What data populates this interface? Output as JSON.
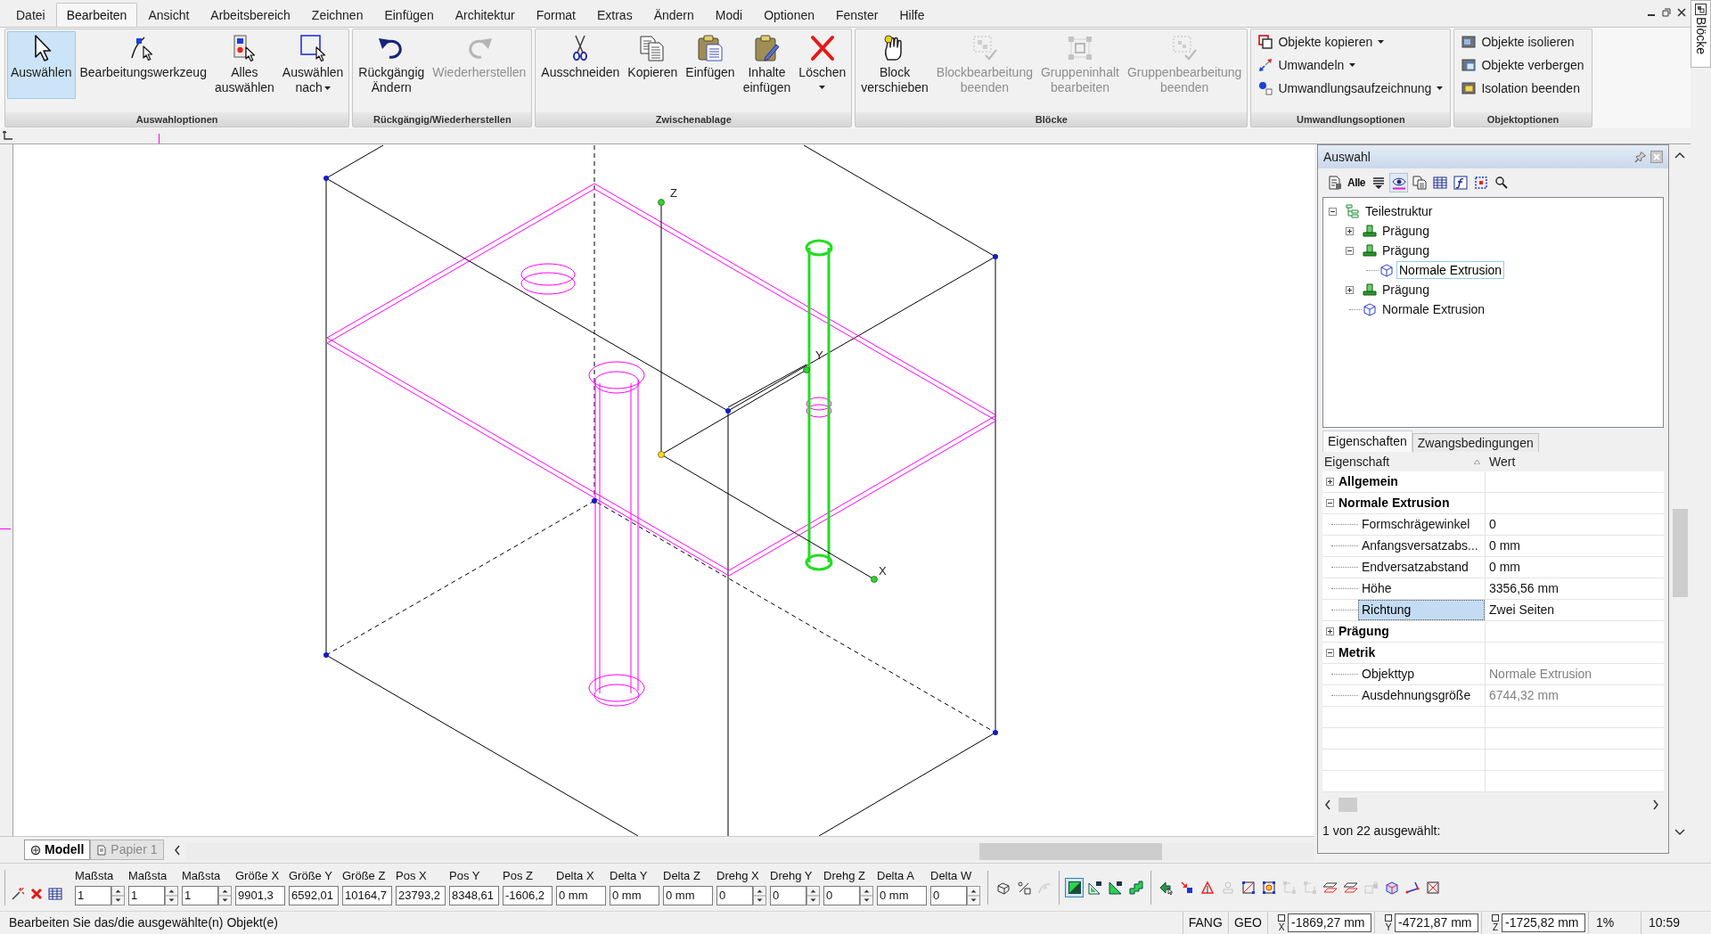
{
  "menu_bar": {
    "items": [
      {
        "label": "Datei",
        "selected": false
      },
      {
        "label": "Bearbeiten",
        "selected": true
      },
      {
        "label": "Ansicht",
        "selected": false
      },
      {
        "label": "Arbeitsbereich",
        "selected": false
      },
      {
        "label": "Zeichnen",
        "selected": false
      },
      {
        "label": "Einfügen",
        "selected": false
      },
      {
        "label": "Architektur",
        "selected": false
      },
      {
        "label": "Format",
        "selected": false
      },
      {
        "label": "Extras",
        "selected": false
      },
      {
        "label": "Ändern",
        "selected": false
      },
      {
        "label": "Modi",
        "selected": false
      },
      {
        "label": "Optionen",
        "selected": false
      },
      {
        "label": "Fenster",
        "selected": false
      },
      {
        "label": "Hilfe",
        "selected": false
      }
    ]
  },
  "ribbon": {
    "groups": [
      {
        "title": "Auswahloptionen",
        "kind": "large",
        "buttons": [
          {
            "label": "Auswählen",
            "kind": "pointer",
            "selected": true,
            "disabled": false,
            "dropdown": false
          },
          {
            "label": "Bearbeitungswerkzeug",
            "kind": "edit-tool",
            "selected": false,
            "disabled": false,
            "dropdown": false
          },
          {
            "label": "Alles\nauswählen",
            "kind": "select-all",
            "selected": false,
            "disabled": false,
            "dropdown": false
          },
          {
            "label": "Auswählen\nnach",
            "kind": "select-frame",
            "selected": false,
            "disabled": false,
            "dropdown": true
          }
        ]
      },
      {
        "title": "Rückgängig/Wiederherstellen",
        "kind": "large",
        "buttons": [
          {
            "label": "Rückgängig\nÄndern",
            "kind": "undo",
            "selected": false,
            "disabled": false,
            "dropdown": false
          },
          {
            "label": "Wiederherstellen",
            "kind": "redo",
            "selected": false,
            "disabled": true,
            "dropdown": false
          }
        ]
      },
      {
        "title": "Zwischenablage",
        "kind": "large",
        "buttons": [
          {
            "label": "Ausschneiden",
            "kind": "scissors",
            "selected": false,
            "disabled": false,
            "dropdown": false
          },
          {
            "label": "Kopieren",
            "kind": "copy",
            "selected": false,
            "disabled": false,
            "dropdown": false
          },
          {
            "label": "Einfügen",
            "kind": "paste",
            "selected": false,
            "disabled": false,
            "dropdown": false
          },
          {
            "label": "Inhalte\neinfügen",
            "kind": "paste-special",
            "selected": false,
            "disabled": false,
            "dropdown": false
          },
          {
            "label": "Löschen",
            "kind": "delete",
            "selected": false,
            "disabled": false,
            "dropdown": true
          }
        ]
      },
      {
        "title": "Blöcke",
        "kind": "large",
        "buttons": [
          {
            "label": "Block\nverschieben",
            "kind": "hand",
            "selected": false,
            "disabled": false,
            "dropdown": false
          },
          {
            "label": "Blockbearbeitung\nbeenden",
            "kind": "block-end",
            "selected": false,
            "disabled": true,
            "dropdown": false
          },
          {
            "label": "Gruppeninhalt\nbearbeiten",
            "kind": "group-edit",
            "selected": false,
            "disabled": true,
            "dropdown": false
          },
          {
            "label": "Gruppenbearbeitung\nbeenden",
            "kind": "group-end",
            "selected": false,
            "disabled": true,
            "dropdown": false
          }
        ]
      },
      {
        "title": "Umwandlungsoptionen",
        "kind": "small",
        "buttons": [
          {
            "label": "Objekte kopieren",
            "kind": "copy-objects",
            "dropdown": true
          },
          {
            "label": "Umwandeln",
            "kind": "transform",
            "dropdown": true
          },
          {
            "label": "Umwandlungsaufzeichnung",
            "kind": "record",
            "dropdown": true
          }
        ]
      },
      {
        "title": "Objektoptionen",
        "kind": "small",
        "buttons": [
          {
            "label": "Objekte isolieren",
            "kind": "isolate",
            "dropdown": false
          },
          {
            "label": "Objekte verbergen",
            "kind": "hide",
            "dropdown": false
          },
          {
            "label": "Isolation beenden",
            "kind": "end-isolation",
            "dropdown": false
          }
        ]
      }
    ]
  },
  "side_tab": {
    "label": "Blöcke"
  },
  "viewport": {
    "axes": [
      {
        "label": "Z"
      },
      {
        "label": "Y"
      },
      {
        "label": "X"
      }
    ],
    "layout_tabs": [
      {
        "label": "Modell",
        "selected": true
      },
      {
        "label": "Papier 1",
        "selected": false
      }
    ]
  },
  "selection_panel": {
    "title": "Auswahl",
    "toolbar": [
      {
        "kind": "properties",
        "selected": false
      },
      {
        "kind": "text",
        "label": "Alle",
        "selected": false
      },
      {
        "kind": "filter",
        "selected": false
      },
      {
        "kind": "eye",
        "selected": true
      },
      {
        "kind": "copy",
        "selected": false
      },
      {
        "kind": "table",
        "selected": false
      },
      {
        "kind": "formula",
        "selected": false
      },
      {
        "kind": "grid",
        "selected": false
      },
      {
        "kind": "zoom",
        "selected": false
      }
    ],
    "tree": [
      {
        "label": "Teilestruktur",
        "kind": "structure",
        "expanded": true,
        "selected": false,
        "children": [
          {
            "label": "Prägung",
            "kind": "emboss",
            "expanded": false,
            "selected": false
          },
          {
            "label": "Prägung",
            "kind": "emboss",
            "expanded": true,
            "selected": false,
            "children": [
              {
                "label": "Normale Extrusion",
                "kind": "extrusion",
                "selected": true
              }
            ]
          },
          {
            "label": "Prägung",
            "kind": "emboss",
            "expanded": false,
            "selected": false
          },
          {
            "label": "Normale Extrusion",
            "kind": "extrusion",
            "selected": false
          }
        ]
      }
    ],
    "tabs": [
      {
        "label": "Eigenschaften",
        "selected": true
      },
      {
        "label": "Zwangsbedingungen",
        "selected": false
      }
    ],
    "columns": [
      "Eigenschaft",
      "Wert"
    ],
    "categories": [
      {
        "label": "Allgemein",
        "expanded": false
      },
      {
        "label": "Normale Extrusion",
        "expanded": true,
        "rows": [
          {
            "name": "Formschrägewinkel",
            "value": "0",
            "selected": false,
            "readonly": false
          },
          {
            "name": "Anfangsversatzabs...",
            "value": "0 mm",
            "selected": false,
            "readonly": false
          },
          {
            "name": "Endversatzabstand",
            "value": "0 mm",
            "selected": false,
            "readonly": false
          },
          {
            "name": "Höhe",
            "value": "3356,56 mm",
            "selected": false,
            "readonly": false
          },
          {
            "name": "Richtung",
            "value": "Zwei Seiten",
            "selected": true,
            "readonly": false
          }
        ]
      },
      {
        "label": "Prägung",
        "expanded": false
      },
      {
        "label": "Metrik",
        "expanded": true,
        "rows": [
          {
            "name": "Objekttyp",
            "value": "Normale Extrusion",
            "selected": false,
            "readonly": true
          },
          {
            "name": "Ausdehnungsgröße",
            "value": "6744,32 mm",
            "selected": false,
            "readonly": true
          }
        ]
      }
    ],
    "status": "1 von 22 ausgewählt:"
  },
  "transform_bar": {
    "fields": [
      {
        "label": "Maßsta",
        "value": "1",
        "spinner": true
      },
      {
        "label": "Maßsta",
        "value": "1",
        "spinner": true
      },
      {
        "label": "Maßsta",
        "value": "1",
        "spinner": true
      },
      {
        "label": "Größe X",
        "value": "9901,3",
        "spinner": false
      },
      {
        "label": "Größe Y",
        "value": "6592,01",
        "spinner": false
      },
      {
        "label": "Größe Z",
        "value": "10164,7",
        "spinner": false
      },
      {
        "label": "Pos X",
        "value": "23793,2",
        "spinner": false
      },
      {
        "label": "Pos Y",
        "value": "8348,61",
        "spinner": false
      },
      {
        "label": "Pos Z",
        "value": "-1606,2",
        "spinner": false
      },
      {
        "label": "Delta X",
        "value": "0 mm",
        "spinner": false
      },
      {
        "label": "Delta Y",
        "value": "0 mm",
        "spinner": false
      },
      {
        "label": "Delta Z",
        "value": "0 mm",
        "spinner": false
      },
      {
        "label": "Drehg X",
        "value": "0",
        "spinner": true
      },
      {
        "label": "Drehg Y",
        "value": "0",
        "spinner": true
      },
      {
        "label": "Drehg Z",
        "value": "0",
        "spinner": true
      },
      {
        "label": "Delta A",
        "value": "0 mm",
        "spinner": false
      },
      {
        "label": "Delta W",
        "value": "0",
        "spinner": true
      }
    ]
  },
  "snap_toolbar": {
    "groups": [
      {
        "tools": [
          {
            "kind": "cube-link",
            "selected": false,
            "disabled": false
          },
          {
            "kind": "cube-percent",
            "selected": false,
            "disabled": false
          },
          {
            "kind": "curve",
            "selected": false,
            "disabled": true
          }
        ]
      },
      {
        "tools": [
          {
            "kind": "snap-square",
            "selected": true,
            "disabled": false
          },
          {
            "kind": "snap-wp",
            "selected": false,
            "disabled": false
          },
          {
            "kind": "snap-cp",
            "selected": false,
            "disabled": false
          },
          {
            "kind": "snap-step",
            "selected": false,
            "disabled": false
          }
        ]
      },
      {
        "tools": [
          {
            "kind": "arrow-snap",
            "selected": false,
            "disabled": false
          },
          {
            "kind": "dots",
            "selected": false,
            "disabled": false
          },
          {
            "kind": "triangle",
            "selected": false,
            "disabled": false
          },
          {
            "kind": "stamp",
            "selected": false,
            "disabled": true
          },
          {
            "kind": "square-diag",
            "selected": false,
            "disabled": false
          },
          {
            "kind": "square-center",
            "selected": false,
            "disabled": false
          },
          {
            "kind": "square-corners",
            "selected": false,
            "disabled": true
          },
          {
            "kind": "square-corners",
            "selected": false,
            "disabled": true
          },
          {
            "kind": "planes",
            "selected": false,
            "disabled": false
          },
          {
            "kind": "planes",
            "selected": false,
            "disabled": false
          },
          {
            "kind": "lock",
            "selected": false,
            "disabled": true
          },
          {
            "kind": "cube-wire",
            "selected": false,
            "disabled": false
          },
          {
            "kind": "line-ends",
            "selected": false,
            "disabled": false
          },
          {
            "kind": "square-cross",
            "selected": false,
            "disabled": false
          }
        ]
      }
    ]
  },
  "status_bar": {
    "message": "Bearbeiten Sie das/die ausgewählte(n) Objekt(e)",
    "indicators": [
      "FANG",
      "GEO"
    ],
    "coordinates": [
      {
        "axis": "X",
        "value": "-1869,27 mm",
        "checked": false
      },
      {
        "axis": "Y",
        "value": "-4721,87 mm",
        "checked": false
      },
      {
        "axis": "Z",
        "value": "-1725,82 mm",
        "checked": false
      }
    ],
    "zoom": "1%",
    "time": "10:59"
  }
}
